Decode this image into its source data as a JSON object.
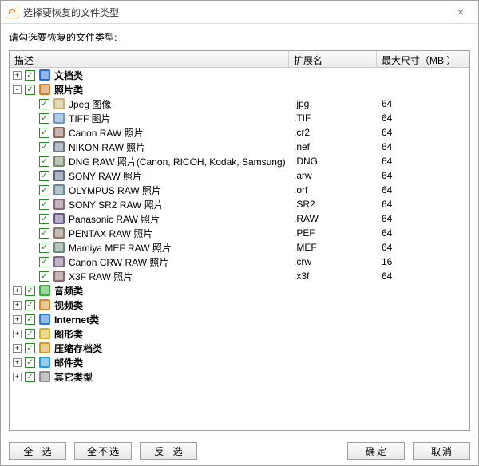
{
  "window": {
    "title": "选择要恢复的文件类型"
  },
  "instruction": "请勾选要恢复的文件类型:",
  "columns": {
    "desc": "描述",
    "ext": "扩展名",
    "size": "最大尺寸（MB ）"
  },
  "tree": [
    {
      "type": "cat",
      "expander": "+",
      "checked": true,
      "icon": "#2a6bd4",
      "label": "文档类",
      "bold": true
    },
    {
      "type": "cat",
      "expander": "-",
      "checked": true,
      "icon": "#d47a2a",
      "label": "照片类",
      "bold": true
    },
    {
      "type": "item",
      "checked": true,
      "icon": "#c9b36a",
      "label": "Jpeg 图像",
      "ext": ".jpg",
      "size": "64"
    },
    {
      "type": "item",
      "checked": true,
      "icon": "#6a9ac9",
      "label": "TIFF 图片",
      "ext": ".TIF",
      "size": "64"
    },
    {
      "type": "item",
      "checked": true,
      "icon": "#8a6a5a",
      "label": "Canon RAW 照片",
      "ext": ".cr2",
      "size": "64"
    },
    {
      "type": "item",
      "checked": true,
      "icon": "#6a7a8a",
      "label": "NIKON RAW 照片",
      "ext": ".nef",
      "size": "64"
    },
    {
      "type": "item",
      "checked": true,
      "icon": "#7a8a6a",
      "label": "DNG RAW 照片(Canon, RICOH, Kodak, Samsung)",
      "ext": ".DNG",
      "size": "64"
    },
    {
      "type": "item",
      "checked": true,
      "icon": "#5a6a8a",
      "label": "SONY RAW 照片",
      "ext": ".arw",
      "size": "64"
    },
    {
      "type": "item",
      "checked": true,
      "icon": "#6a8a9a",
      "label": "OLYMPUS RAW 照片",
      "ext": ".orf",
      "size": "64"
    },
    {
      "type": "item",
      "checked": true,
      "icon": "#8a6a7a",
      "label": "SONY SR2 RAW 照片",
      "ext": ".SR2",
      "size": "64"
    },
    {
      "type": "item",
      "checked": true,
      "icon": "#6a5a8a",
      "label": "Panasonic RAW 照片",
      "ext": ".RAW",
      "size": "64"
    },
    {
      "type": "item",
      "checked": true,
      "icon": "#8a7a6a",
      "label": "PENTAX RAW 照片",
      "ext": ".PEF",
      "size": "64"
    },
    {
      "type": "item",
      "checked": true,
      "icon": "#6a8a7a",
      "label": "Mamiya MEF RAW 照片",
      "ext": ".MEF",
      "size": "64"
    },
    {
      "type": "item",
      "checked": true,
      "icon": "#7a6a8a",
      "label": "Canon CRW RAW 照片",
      "ext": ".crw",
      "size": "16"
    },
    {
      "type": "item",
      "checked": true,
      "icon": "#8a6a6a",
      "label": "X3F RAW 照片",
      "ext": ".x3f",
      "size": "64"
    },
    {
      "type": "cat",
      "expander": "+",
      "checked": true,
      "icon": "#3aaa3a",
      "label": "音频类",
      "bold": true
    },
    {
      "type": "cat",
      "expander": "+",
      "checked": true,
      "icon": "#d48a2a",
      "label": "视频类",
      "bold": true
    },
    {
      "type": "cat",
      "expander": "+",
      "checked": true,
      "icon": "#2a7ad4",
      "label": "Internet类",
      "bold": true
    },
    {
      "type": "cat",
      "expander": "+",
      "checked": true,
      "icon": "#d4b42a",
      "label": "图形类",
      "bold": true
    },
    {
      "type": "cat",
      "expander": "+",
      "checked": true,
      "icon": "#d49a2a",
      "label": "压缩存档类",
      "bold": true
    },
    {
      "type": "cat",
      "expander": "+",
      "checked": true,
      "icon": "#2a9ad4",
      "label": "邮件类",
      "bold": true
    },
    {
      "type": "cat",
      "expander": "+",
      "checked": true,
      "icon": "#8a8a8a",
      "label": "其它类型",
      "bold": true
    }
  ],
  "buttons": {
    "select_all": "全 选",
    "select_none": "全不选",
    "invert": "反 选",
    "ok": "确定",
    "cancel": "取消"
  }
}
